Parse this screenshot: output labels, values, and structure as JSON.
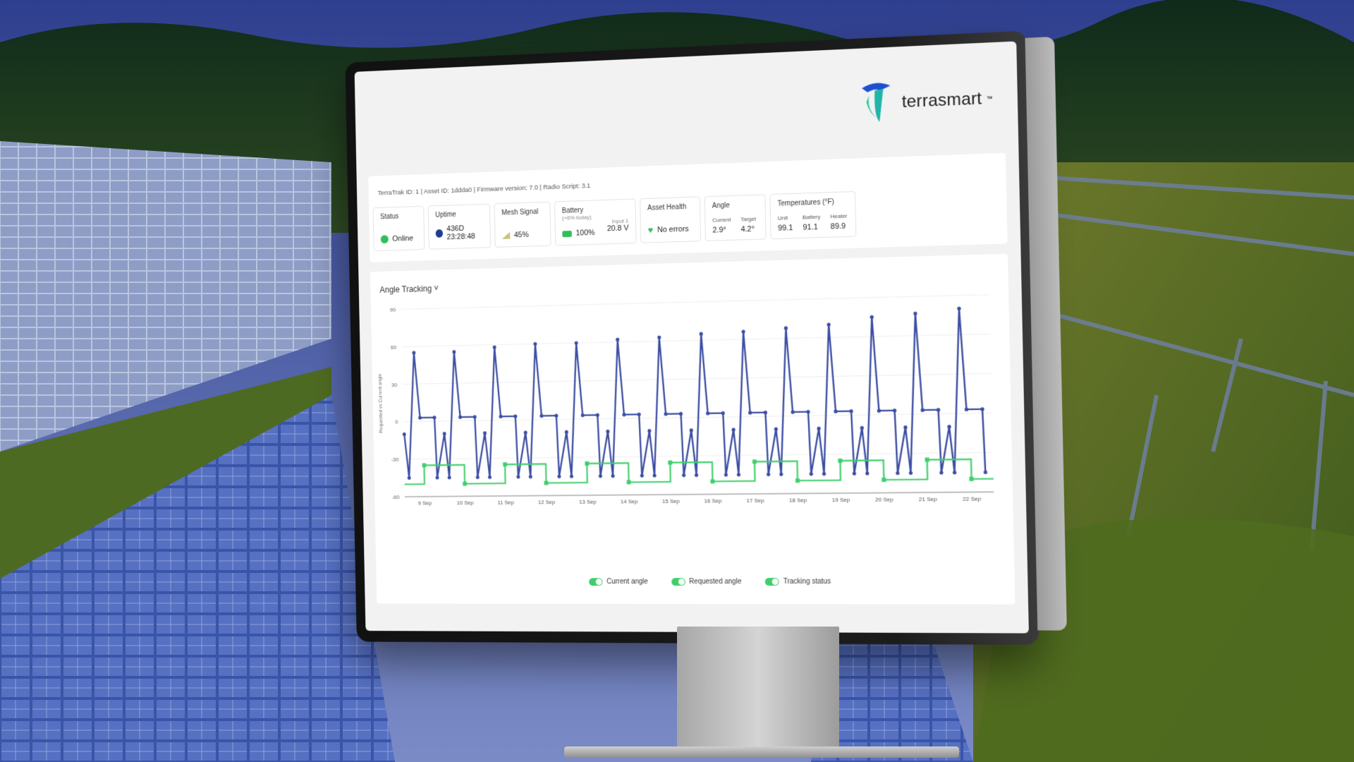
{
  "logo": {
    "text": "terrasmart",
    "tm": "™"
  },
  "meta_line": "TerraTrak ID: 1 | Asset ID: 1ddda0 | Firmware version: 7.0 | Radio Script: 3.1",
  "stats": {
    "status": {
      "title": "Status",
      "value": "Online"
    },
    "uptime": {
      "title": "Uptime",
      "value": "436D 23:28:48"
    },
    "mesh": {
      "title": "Mesh Signal",
      "value": "45%"
    },
    "battery": {
      "title": "Battery",
      "sub": "(+6% today)",
      "value": "100%",
      "input_label": "Input 1",
      "input_value": "20.8 V"
    },
    "health": {
      "title": "Asset Health",
      "value": "No errors"
    },
    "angle": {
      "title": "Angle",
      "current_label": "Current",
      "current_value": "2.9°",
      "target_label": "Target",
      "target_value": "4.2°"
    },
    "temps": {
      "title": "Temperatures (°F)",
      "unit_label": "Unit",
      "unit_value": "99.1",
      "battery_label": "Battery",
      "battery_value": "91.1",
      "heater_label": "Heater",
      "heater_value": "89.9"
    }
  },
  "chart_title": "Angle Tracking ˅",
  "legend": [
    "Current angle",
    "Requested angle",
    "Tracking status"
  ],
  "colors": {
    "current": "#3c4ea3",
    "requested": "#3c4ea3",
    "tracking": "#3ecf6a",
    "online": "#2fbf5a",
    "logo_teal": "#1fb5a8",
    "logo_blue": "#1f4fd1"
  },
  "chart_data": {
    "type": "line",
    "ylabel": "Requested vs Current angle",
    "yticks": [
      90,
      60,
      30,
      0,
      -30,
      -60
    ],
    "ylim": [
      -60,
      90
    ],
    "x": [
      "9 Sep",
      "10 Sep",
      "11 Sep",
      "12 Sep",
      "13 Sep",
      "14 Sep",
      "15 Sep",
      "16 Sep",
      "17 Sep",
      "18 Sep",
      "19 Sep",
      "20 Sep",
      "21 Sep",
      "22 Sep"
    ],
    "series": [
      {
        "name": "Current angle",
        "daily_peak": [
          55,
          55,
          58,
          60,
          60,
          62,
          63,
          65,
          66,
          68,
          70,
          75,
          77,
          80
        ],
        "daily_low": -45,
        "midday_plateau": 3
      },
      {
        "name": "Requested angle",
        "daily_peak": [
          55,
          55,
          58,
          60,
          60,
          62,
          63,
          65,
          66,
          68,
          70,
          75,
          77,
          80
        ],
        "daily_low": -45,
        "midday_plateau": 3
      },
      {
        "name": "Tracking status",
        "level_range": [
          -50,
          -35
        ]
      }
    ]
  }
}
